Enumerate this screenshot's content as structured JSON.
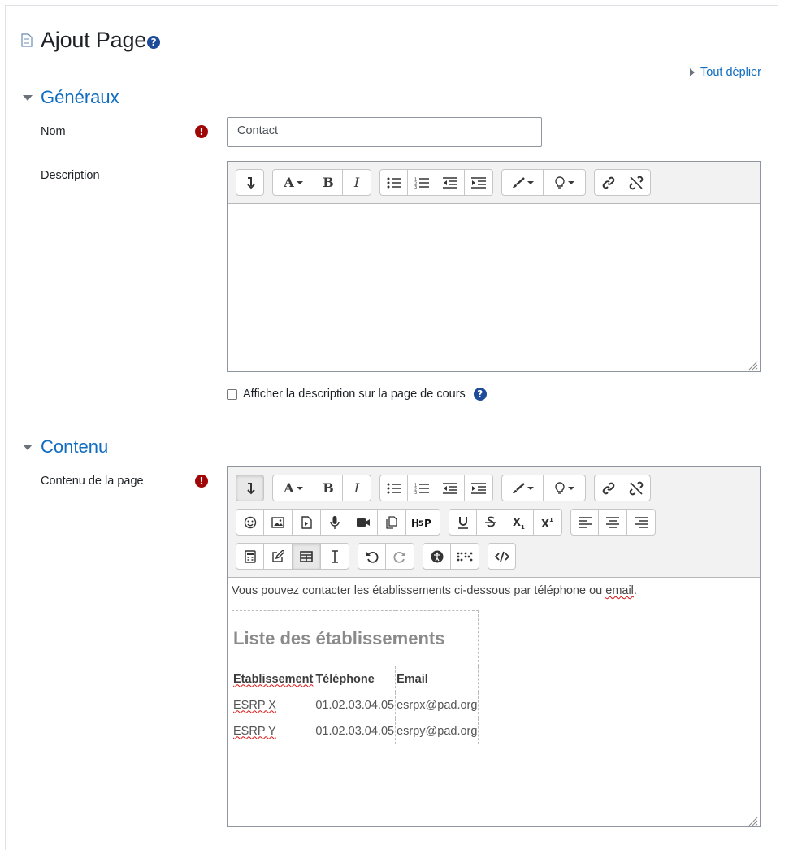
{
  "page": {
    "title": "Ajout Page",
    "expand_all": "Tout déplier"
  },
  "sections": {
    "general": {
      "title": "Généraux"
    },
    "content": {
      "title": "Contenu"
    }
  },
  "fields": {
    "name_label": "Nom",
    "name_value": "Contact",
    "description_label": "Description",
    "show_description_label": "Afficher la description sur la page de cours",
    "page_content_label": "Contenu de la page"
  },
  "content_editor": {
    "intro_before": "Vous pouvez contacter les établissements ci-dessous par téléphone ou ",
    "intro_link_word": "email",
    "intro_after": ".",
    "table": {
      "caption": "Liste des établissements",
      "headers": [
        "Etablissement",
        "Téléphone",
        "Email"
      ],
      "rows": [
        [
          "ESRP X",
          "01.02.03.04.05",
          "esrpx@pad.org"
        ],
        [
          "ESRP Y",
          "01.02.03.04.05",
          "esrpy@pad.org"
        ]
      ]
    }
  },
  "colors": {
    "link_blue": "#0f6cbf",
    "required_red": "#a10606",
    "help_blue": "#1e4a9a"
  },
  "icons": {
    "toolbar_row1": [
      "show-more-icon",
      "font-style-icon",
      "bold-icon",
      "italic-icon",
      "unordered-list-icon",
      "ordered-list-icon",
      "outdent-icon",
      "indent-icon",
      "font-color-icon",
      "background-color-icon",
      "link-icon",
      "unlink-icon"
    ],
    "toolbar_row2": [
      "emoticon-icon",
      "image-icon",
      "media-icon",
      "record-audio-icon",
      "record-video-icon",
      "manage-files-icon",
      "h5p-icon",
      "underline-icon",
      "strikethrough-icon",
      "subscript-icon",
      "superscript-icon",
      "align-left-icon",
      "align-center-icon",
      "align-right-icon"
    ],
    "toolbar_row3": [
      "equation-icon",
      "edit-icon",
      "table-icon",
      "character-map-icon",
      "undo-icon",
      "redo-icon",
      "accessibility-checker-icon",
      "screenreader-helper-icon",
      "html-source-icon"
    ]
  }
}
